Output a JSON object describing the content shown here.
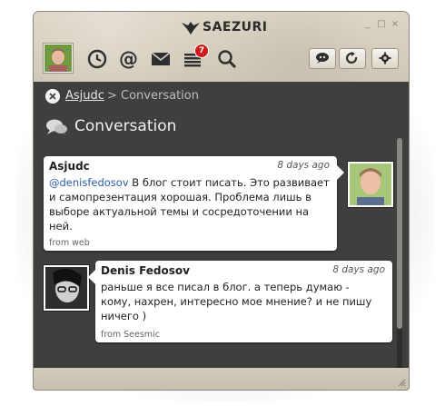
{
  "app": {
    "title": "SAEZURI",
    "window_controls": [
      "_",
      "□",
      "×"
    ]
  },
  "toolbar": {
    "nav_icons": [
      "clock-icon",
      "at-mention-icon",
      "envelope-icon",
      "list-icon",
      "search-icon"
    ],
    "list_badge": "7",
    "right_buttons": [
      "profile-chat-icon",
      "refresh-icon",
      "settings-gear-icon"
    ]
  },
  "breadcrumb": {
    "link": "Asjudc",
    "separator": " > ",
    "current": "Conversation"
  },
  "section": {
    "title": "Conversation"
  },
  "messages": [
    {
      "author": "Asjudc",
      "time": "8 days ago",
      "mention": "@denisfedosov",
      "text": " В блог стоит писать. Это развивает и самопрезентация хорошая. Проблема лишь в выборе актуальной темы и сосредоточении на ней.",
      "source": "from web"
    },
    {
      "author": "Denis Fedosov",
      "time": "8 days ago",
      "text": "раньше я все писал в блог. а теперь думаю - кому, нахрен, интересно мое мнение? и не пишу ничего )",
      "source": "from Seesmic"
    }
  ],
  "colors": {
    "chrome": "#d8d1c2",
    "content_bg": "#403f3d",
    "bubble": "#ffffff",
    "badge": "#d21a1a",
    "mention": "#2d5fa6"
  }
}
